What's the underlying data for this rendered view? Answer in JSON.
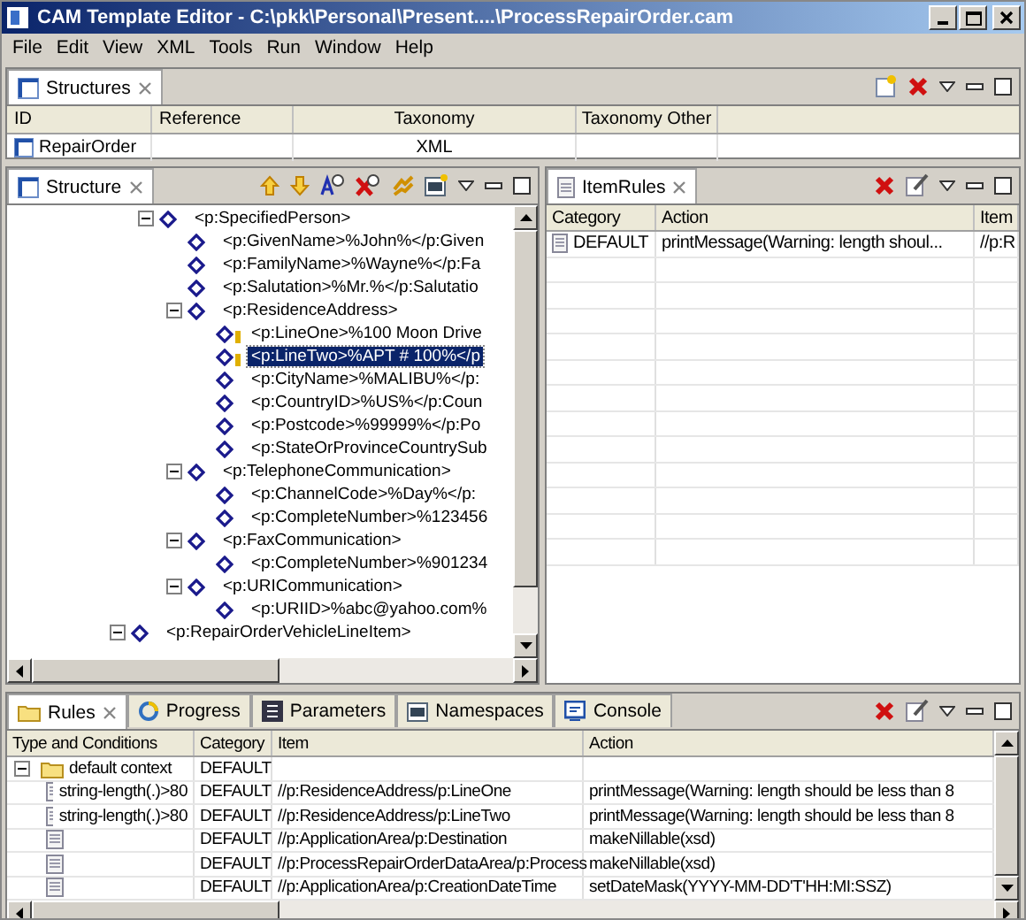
{
  "window": {
    "title": "CAM Template Editor - C:\\pkk\\Personal\\Present....\\ProcessRepairOrder.cam"
  },
  "menu": [
    "File",
    "Edit",
    "View",
    "XML",
    "Tools",
    "Run",
    "Window",
    "Help"
  ],
  "structures_view": {
    "tab": "Structures",
    "columns": [
      "ID",
      "Reference",
      "Taxonomy",
      "Taxonomy Other"
    ],
    "rows": [
      {
        "id": "RepairOrder",
        "taxonomy": "XML"
      }
    ]
  },
  "structure_view": {
    "tab": "Structure",
    "tree": [
      {
        "label": "<p:SpecifiedPerson>",
        "expanded": true,
        "selected": false,
        "children": [
          {
            "label": "<p:GivenName>%John%</p:Given",
            "selected": false
          },
          {
            "label": "<p:FamilyName>%Wayne%</p:Fa",
            "selected": false
          },
          {
            "label": "<p:Salutation>%Mr.%</p:Salutatio",
            "selected": false
          },
          {
            "label": "<p:ResidenceAddress>",
            "expanded": true,
            "selected": false,
            "children": [
              {
                "label": "<p:LineOne>%100 Moon Drive",
                "selected": false,
                "flagged": true
              },
              {
                "label": "<p:LineTwo>%APT # 100%</p",
                "selected": true,
                "flagged": true
              },
              {
                "label": "<p:CityName>%MALIBU%</p:",
                "selected": false
              },
              {
                "label": "<p:CountryID>%US%</p:Coun",
                "selected": false
              },
              {
                "label": "<p:Postcode>%99999%</p:Po",
                "selected": false
              },
              {
                "label": "<p:StateOrProvinceCountrySub",
                "selected": false
              }
            ]
          },
          {
            "label": "<p:TelephoneCommunication>",
            "expanded": true,
            "selected": false,
            "children": [
              {
                "label": "<p:ChannelCode>%Day%</p:",
                "selected": false
              },
              {
                "label": "<p:CompleteNumber>%123456",
                "selected": false
              }
            ]
          },
          {
            "label": "<p:FaxCommunication>",
            "expanded": true,
            "selected": false,
            "children": [
              {
                "label": "<p:CompleteNumber>%901234",
                "selected": false
              }
            ]
          },
          {
            "label": "<p:URICommunication>",
            "expanded": true,
            "selected": false,
            "children": [
              {
                "label": "<p:URIID>%abc@yahoo.com%",
                "selected": false
              }
            ]
          }
        ]
      },
      {
        "label": "<p:RepairOrderVehicleLineItem>",
        "expanded": true,
        "selected": false
      }
    ]
  },
  "item_rules_view": {
    "tab": "ItemRules",
    "columns": [
      "Category",
      "Action",
      "Item"
    ],
    "rows": [
      {
        "category": "DEFAULT",
        "action": "printMessage(Warning: length shoul...",
        "item": "//p:R"
      }
    ]
  },
  "bottom_view": {
    "tabs": [
      {
        "label": "Rules",
        "selected": true
      },
      {
        "label": "Progress",
        "selected": false
      },
      {
        "label": "Parameters",
        "selected": false
      },
      {
        "label": "Namespaces",
        "selected": false
      },
      {
        "label": "Console",
        "selected": false
      }
    ],
    "columns": [
      "Type and Conditions",
      "Category",
      "Item",
      "Action"
    ],
    "rows": [
      {
        "condition": "default context",
        "category": "DEFAULT",
        "expanded": true,
        "children": [
          {
            "condition": "string-length(.)>80",
            "category": "DEFAULT",
            "item": "//p:ResidenceAddress/p:LineOne",
            "action": "printMessage(Warning: length should be less than 8"
          },
          {
            "condition": "string-length(.)>80",
            "category": "DEFAULT",
            "item": "//p:ResidenceAddress/p:LineTwo",
            "action": "printMessage(Warning: length should be less than 8"
          },
          {
            "category": "DEFAULT",
            "item": "//p:ApplicationArea/p:Destination",
            "action": "makeNillable(xsd)"
          },
          {
            "category": "DEFAULT",
            "item": "//p:ProcessRepairOrderDataArea/p:Process",
            "action": "makeNillable(xsd)"
          },
          {
            "category": "DEFAULT",
            "item": "//p:ApplicationArea/p:CreationDateTime",
            "action": "setDateMask(YYYY-MM-DD'T'HH:MI:SSZ)"
          }
        ]
      }
    ]
  }
}
